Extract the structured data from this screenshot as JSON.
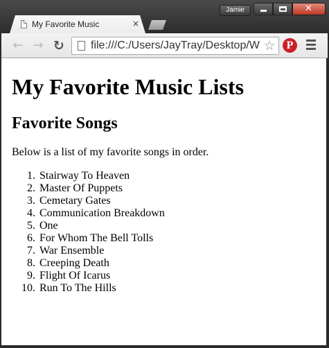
{
  "browser": {
    "tab_title": "My Favorite Music",
    "tab_close_glyph": "×",
    "profile_name": "Jamie",
    "url": "file:///C:/Users/JayTray/Desktop/W",
    "icons": [
      "page-icon",
      "back-arrow-icon",
      "forward-arrow-icon",
      "reload-icon",
      "star-icon",
      "pinterest-icon",
      "menu-icon",
      "minimize-icon",
      "maximize-icon",
      "close-icon"
    ],
    "glyphs": {
      "back": "←",
      "forward": "→",
      "reload": "↻",
      "star": "☆",
      "pinterest": "P",
      "close": "✕"
    }
  },
  "page": {
    "h1": "My Favorite Music Lists",
    "h2": "Favorite Songs",
    "intro": "Below is a list of my favorite songs in order.",
    "songs": [
      {
        "num": "1.",
        "title": "Stairway To Heaven"
      },
      {
        "num": "2.",
        "title": "Master Of Puppets"
      },
      {
        "num": "3.",
        "title": "Cemetary Gates"
      },
      {
        "num": "4.",
        "title": "Communication Breakdown"
      },
      {
        "num": "5.",
        "title": "One"
      },
      {
        "num": "6.",
        "title": "For Whom The Bell Tolls"
      },
      {
        "num": "7.",
        "title": "War Ensemble"
      },
      {
        "num": "8.",
        "title": "Creeping Death"
      },
      {
        "num": "9.",
        "title": "Flight Of Icarus"
      },
      {
        "num": "10.",
        "title": "Run To The Hills"
      }
    ]
  }
}
